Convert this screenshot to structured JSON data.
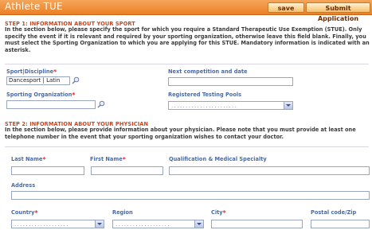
{
  "header": {
    "title": "Athlete TUE",
    "save_label": "save",
    "submit_label": "Submit Application"
  },
  "step1": {
    "title": "STEP 1: INFORMATION ABOUT YOUR SPORT",
    "description": "In the section below, please specify the sport for which you require a Standard Therapeutic Use Exemption (STUE). Only specify the event if it is relevant and required by your sporting organization, otherwise leave this field blank. Finally, you must select the Sporting Organization to which you are applying for this STUE. Mandatory information is indicated with an asterisk.",
    "sport_label": "Sport|Discipline",
    "sport_value": "Dancesport | Latin",
    "next_competition_label": "Next competition and date",
    "next_competition_value": "",
    "organization_label": "Sporting Organization",
    "organization_value": "",
    "testing_pools_label": "Registered Testing Pools",
    "testing_pools_dots": "......................."
  },
  "step2": {
    "title": "STEP 2: INFORMATION ABOUT YOUR PHYSICIAN",
    "description": "In the section below, please provide information about your physician. Please note that you must provide at least one telephone number in the event that your sporting organization wishes to contact your doctor.",
    "last_name_label": "Last Name",
    "first_name_label": "First Name",
    "qualification_label": "Qualification & Medical Specialty",
    "address_label": "Address",
    "country_label": "Country",
    "country_dots": "...................",
    "region_label": "Region",
    "region_dots": "...................",
    "city_label": "City",
    "postal_label": "Postal code/Zip"
  },
  "required_mark": "*",
  "colors": {
    "header_orange": "#ec8024",
    "step_title": "#c8461f",
    "label_blue": "#4a6aa6",
    "required_red": "#e03030"
  },
  "icons": {
    "lookup": "magnifier-icon",
    "dropdown": "chevron-down-icon"
  }
}
